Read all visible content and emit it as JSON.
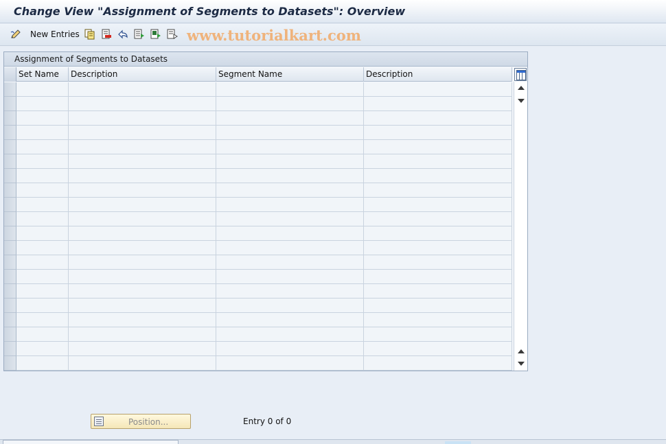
{
  "window": {
    "title": "Change View \"Assignment of Segments to Datasets\": Overview"
  },
  "toolbar": {
    "new_entries_label": "New Entries",
    "icons": [
      "edit-pencil-icon",
      "copy-icon",
      "delete-icon",
      "undo-icon",
      "select-all-icon",
      "select-block-icon",
      "deselect-all-icon"
    ],
    "watermark": "www.tutorialkart.com"
  },
  "table": {
    "title": "Assignment of Segments to Datasets",
    "columns": [
      "Set Name",
      "Description",
      "Segment Name",
      "Description"
    ],
    "rows": []
  },
  "footer": {
    "position_label": "Position...",
    "entry_text": "Entry 0 of 0"
  }
}
